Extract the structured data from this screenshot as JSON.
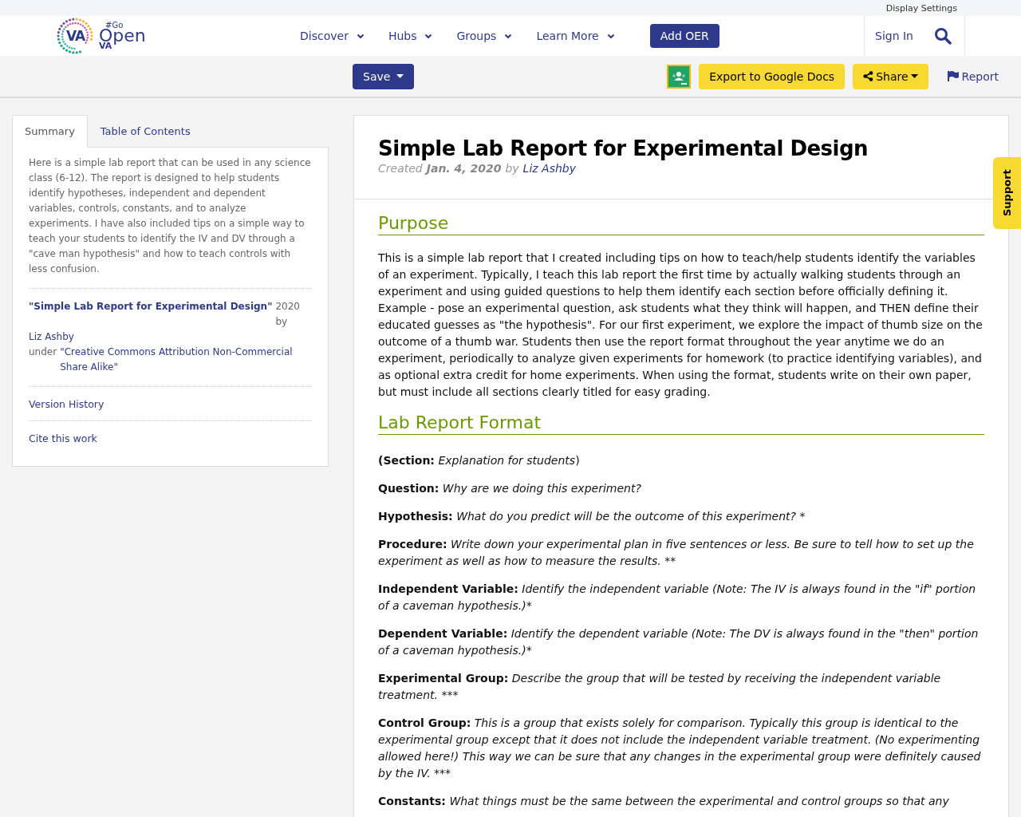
{
  "top_bar": {
    "link": "Display Settings"
  },
  "logo": {
    "mark": "VA",
    "hashtag": "#Go",
    "word": "Open",
    "sub": "VA"
  },
  "nav": [
    {
      "label": "Discover",
      "dropdown": true
    },
    {
      "label": "Hubs",
      "dropdown": true
    },
    {
      "label": "Groups",
      "dropdown": true
    },
    {
      "label": "Learn More",
      "dropdown": true
    }
  ],
  "add_button": "Add OER",
  "sign_in": "Sign In",
  "toolbar": {
    "save": "Save",
    "export": "Export to Google Docs",
    "share": "Share",
    "report": "Report"
  },
  "sidebar": {
    "tabs": [
      {
        "label": "Summary",
        "selected": true
      },
      {
        "label": "Table of Contents",
        "selected": false
      }
    ],
    "summary": "Here is a simple lab report that can be used in any science class (6-12). The report is designed to help students identify hypotheses, independent and dependent variables, controls, constants, and to analyze experiments. I have also included tips on a simple way to teach your students to identify the IV and DV through a \"cave man hypothesis\" and how to teach controls with less confusion.",
    "attribution": {
      "title": "\"Simple Lab Report for Experimental Design\"",
      "year_by": "2020 by",
      "author": "Liz Ashby",
      "under": "under",
      "license": "\"Creative Commons Attribution Non-Commercial Share Alike\""
    },
    "links": [
      "Version History",
      "Cite this work"
    ]
  },
  "article": {
    "title": "Simple Lab Report for Experimental Design",
    "created_label": "Created",
    "date": "Jan. 4, 2020",
    "by": "by",
    "author": "Liz Ashby",
    "sections": [
      {
        "heading": "Purpose",
        "paragraphs": [
          "This is a simple lab report that I created including tips on how to teach/help students identify the variables of an experiment. Typically, I teach this lab report the first time by actually walking students through an experiment and using guided questions to help them identify each section before officially defining it. Example - pose an experimental question, ask students what they think will happen, and THEN define their educated guesses as \"the hypothesis\". For our first experiment, we explore the impact of thumb size on the outcome of a thumb war. Students then use the report format throughout the year anytime we do an experiment, periodically to analyze given experiments for homework (to practice identifying variables), and as optional extra credit for home experiments. When using the format, students write on their own paper, but must include all sections clearly titled for easy grading."
        ]
      },
      {
        "heading": "Lab Report Format",
        "items": [
          {
            "label": "(Section:",
            "text": "Explanation for students",
            "suffix": ")"
          },
          {
            "label": "Question:",
            "text": "Why are we doing this experiment?"
          },
          {
            "label": "Hypothesis:",
            "text": "What do you predict will be the outcome of this experiment? *"
          },
          {
            "label": "Procedure:",
            "text": "Write down your experimental plan in five sentences or less. Be sure to tell how to set up the experiment as well as how to measure the results. **"
          },
          {
            "label": "Independent Variable:",
            "text": "Identify the independent variable (Note: The IV is always found in the \"if\" portion of a caveman hypothesis.)*"
          },
          {
            "label": "Dependent Variable:",
            "text": "Identify the dependent variable (Note: The DV is always found in the \"then\" portion of a caveman hypothesis.)*"
          },
          {
            "label": "Experimental Group:",
            "text": "Describe the group that will be tested by receiving the independent variable treatment. ***"
          },
          {
            "label": "Control Group:",
            "text": "This is a group that exists solely for comparison. Typically this group is identical to the experimental group except that it does not include the independent variable treatment. (No experimenting allowed here!) This way we can be sure that any changes in the experimental group were definitely caused by the IV. ***"
          },
          {
            "label": "Constants:",
            "text": "What things must be the same between the experimental and control groups so that any"
          }
        ]
      }
    ]
  },
  "support_tab": "Support"
}
